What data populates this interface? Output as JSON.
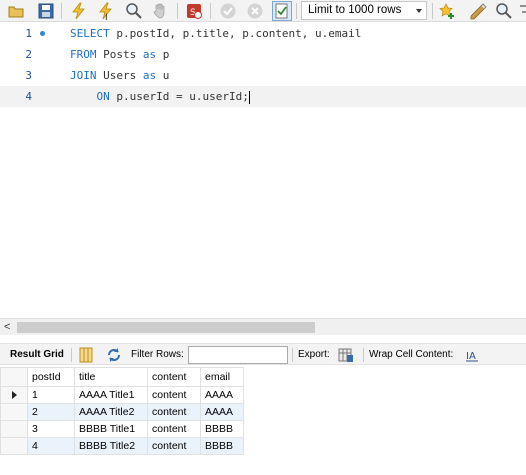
{
  "toolbar": {
    "buttons": [
      {
        "name": "open-folder-icon",
        "icon": "folder-icon"
      },
      {
        "name": "save-icon",
        "icon": "floppy-icon"
      },
      {
        "name": "execute-icon",
        "icon": "lightning-icon"
      },
      {
        "name": "execute-current-icon",
        "icon": "lightning-cursor-icon"
      },
      {
        "name": "explain-icon",
        "icon": "magnifier-icon"
      },
      {
        "name": "stop-icon",
        "icon": "hand-icon"
      },
      {
        "name": "stop-on-error-icon",
        "icon": "stop-badge-icon"
      },
      {
        "name": "commit-icon",
        "icon": "check-icon"
      },
      {
        "name": "rollback-icon",
        "icon": "cancel-icon"
      },
      {
        "name": "autocommit-icon",
        "icon": "autocommit-icon"
      }
    ],
    "limit_select_value": "Limit to 1000 rows",
    "right_icons": [
      "bookmark-star-icon",
      "beautify-icon",
      "find-icon",
      "wrap-icon"
    ],
    "accent_color": "#1e6fc4"
  },
  "editor": {
    "lines": [
      {
        "number": "1",
        "tokens": [
          [
            "kw",
            "SELECT"
          ],
          [
            "txt",
            " p.postId, p.title, p.content, u.email"
          ]
        ]
      },
      {
        "number": "2",
        "tokens": [
          [
            "kw",
            "FROM"
          ],
          [
            "txt",
            " Posts "
          ],
          [
            "kw",
            "as"
          ],
          [
            "txt",
            " p"
          ]
        ]
      },
      {
        "number": "3",
        "tokens": [
          [
            "kw",
            "JOIN"
          ],
          [
            "txt",
            " Users "
          ],
          [
            "kw",
            "as"
          ],
          [
            "txt",
            " u"
          ]
        ]
      },
      {
        "number": "4",
        "tokens": [
          [
            "txt",
            "    "
          ],
          [
            "kw",
            "ON"
          ],
          [
            "txt",
            " p.userId = u.userId;"
          ]
        ]
      }
    ]
  },
  "results": {
    "tab_label": "Result Grid",
    "filter_label": "Filter Rows:",
    "filter_value": "",
    "export_label": "Export:",
    "wrap_label": "Wrap Cell Content:",
    "columns": [
      "postId",
      "title",
      "content",
      "email"
    ],
    "rows": [
      [
        "1",
        "AAAA Title1",
        "content",
        "AAAA"
      ],
      [
        "2",
        "AAAA Title2",
        "content",
        "AAAA"
      ],
      [
        "3",
        "BBBB Title1",
        "content",
        "BBBB"
      ],
      [
        "4",
        "BBBB Title2",
        "content",
        "BBBB"
      ]
    ],
    "alt_row_color": "#eaf2fb"
  }
}
